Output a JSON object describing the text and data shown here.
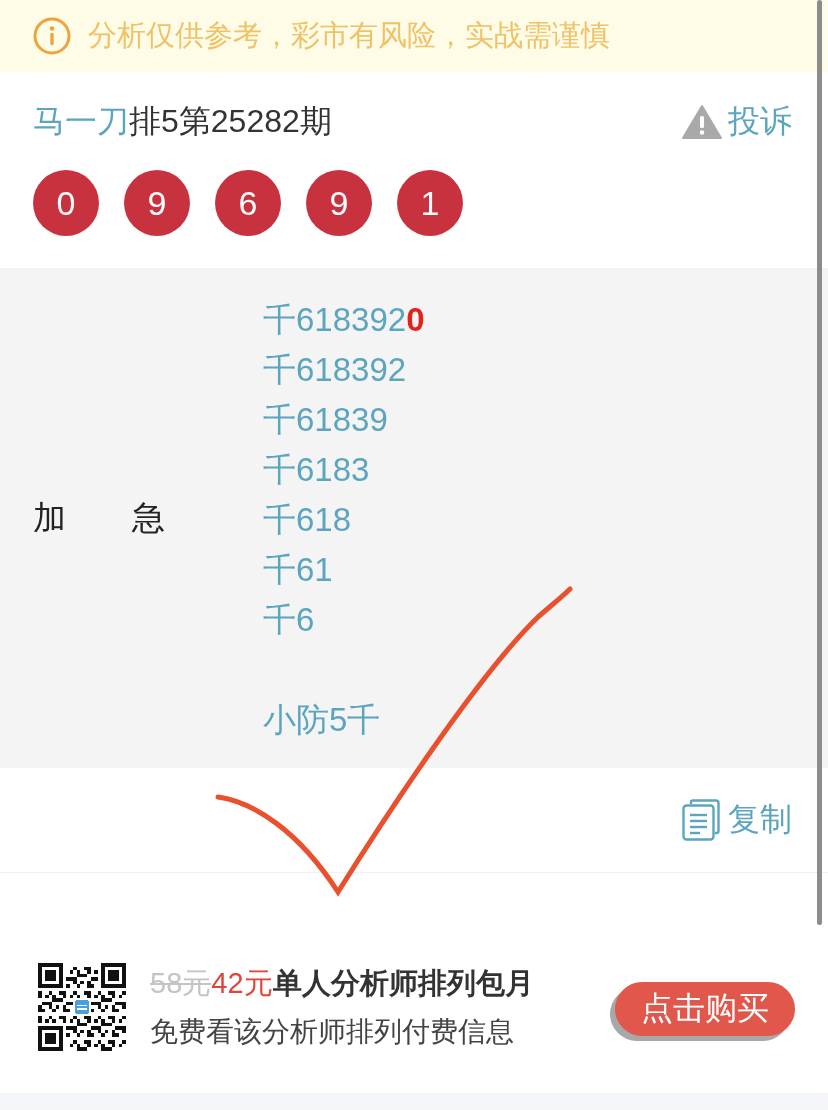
{
  "notice": {
    "text": "分析仅供参考，彩市有风险，实战需谨慎"
  },
  "header": {
    "author": "马一刀",
    "title": "排5第25282期",
    "report": "投诉"
  },
  "balls": [
    "0",
    "9",
    "6",
    "9",
    "1"
  ],
  "picks": {
    "label": "加　　急",
    "groups": [
      [
        "千618392**0**",
        "千618392",
        "千61839",
        "千6183",
        "千618",
        "千61",
        "千6"
      ],
      [
        "小防5千"
      ]
    ]
  },
  "copy": {
    "label": "复制"
  },
  "promo": {
    "old_price": "58元",
    "price": "42元",
    "title": "单人分析师排列包月",
    "subtitle": "免费看该分析师排列付费信息",
    "button": "点击购买"
  }
}
